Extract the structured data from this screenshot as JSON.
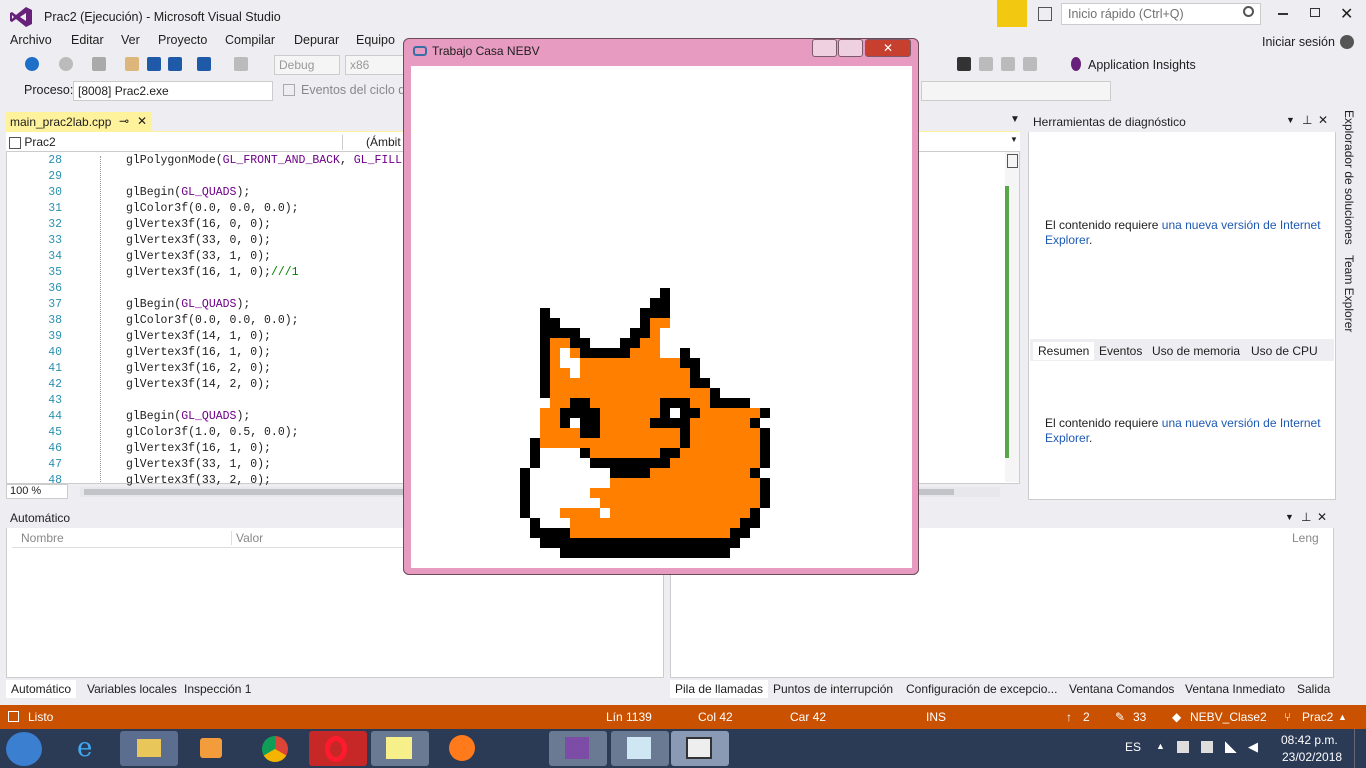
{
  "window": {
    "title": "Prac2 (Ejecución) - Microsoft Visual Studio",
    "quick_launch_placeholder": "Inicio rápido (Ctrl+Q)",
    "sign_in": "Iniciar sesión"
  },
  "menu": [
    "Archivo",
    "Editar",
    "Ver",
    "Proyecto",
    "Compilar",
    "Depurar",
    "Equipo"
  ],
  "toolbar": {
    "config": "Debug",
    "platform": "x86",
    "app_insights": "Application Insights",
    "process_label": "Proceso:",
    "process_value": "[8008] Prac2.exe",
    "lifecycle_events": "Eventos del ciclo de"
  },
  "editor": {
    "tab_name": "main_prac2lab.cpp",
    "nav_left": "Prac2",
    "nav_mid": "(Ámbit",
    "zoom": "100 %",
    "lines": [
      {
        "n": "28",
        "t": "glPolygonMode(GL_FRONT_AND_BACK, GL_FILL"
      },
      {
        "n": "29",
        "t": ""
      },
      {
        "n": "30",
        "t": "glBegin(GL_QUADS);"
      },
      {
        "n": "31",
        "t": "glColor3f(0.0, 0.0, 0.0);"
      },
      {
        "n": "32",
        "t": "glVertex3f(16, 0, 0);"
      },
      {
        "n": "33",
        "t": "glVertex3f(33, 0, 0);"
      },
      {
        "n": "34",
        "t": "glVertex3f(33, 1, 0);"
      },
      {
        "n": "35",
        "t": "glVertex3f(16, 1, 0);",
        "c": "///1"
      },
      {
        "n": "36",
        "t": ""
      },
      {
        "n": "37",
        "t": "glBegin(GL_QUADS);"
      },
      {
        "n": "38",
        "t": "glColor3f(0.0, 0.0, 0.0);"
      },
      {
        "n": "39",
        "t": "glVertex3f(14, 1, 0);"
      },
      {
        "n": "40",
        "t": "glVertex3f(16, 1, 0);"
      },
      {
        "n": "41",
        "t": "glVertex3f(16, 2, 0);"
      },
      {
        "n": "42",
        "t": "glVertex3f(14, 2, 0);"
      },
      {
        "n": "43",
        "t": ""
      },
      {
        "n": "44",
        "t": "glBegin(GL_QUADS);"
      },
      {
        "n": "45",
        "t": "glColor3f(1.0, 0.5, 0.0);"
      },
      {
        "n": "46",
        "t": "glVertex3f(16, 1, 0);"
      },
      {
        "n": "47",
        "t": "glVertex3f(33, 1, 0);"
      },
      {
        "n": "48",
        "t": "glVertex3f(33, 2, 0);"
      }
    ]
  },
  "diagnostics": {
    "title": "Herramientas de diagnóstico",
    "msg_text": "El contenido requiere",
    "msg_link": "una nueva versión de Internet",
    "msg_link2": "Explorer",
    "tabs": [
      "Resumen",
      "Eventos",
      "Uso de memoria",
      "Uso de CPU"
    ]
  },
  "side": [
    "Explorador de soluciones",
    "Team Explorer"
  ],
  "auto_panel": {
    "title": "Automático",
    "col_name": "Nombre",
    "col_value": "Valor",
    "col_lang": "Leng"
  },
  "bottom_tabs_left": [
    "Automático",
    "Variables locales",
    "Inspección 1"
  ],
  "bottom_tabs_right": [
    "Pila de llamadas",
    "Puntos de interrupción",
    "Configuración de excepcio...",
    "Ventana Comandos",
    "Ventana Inmediato",
    "Salida"
  ],
  "status": {
    "ready": "Listo",
    "line": "Lín 1139",
    "col": "Col 42",
    "car": "Car 42",
    "ins": "INS",
    "up": "2",
    "edits": "33",
    "repo": "NEBV_Clase2",
    "branch": "Prac2"
  },
  "taskbar": {
    "lang": "ES",
    "time": "08:42 p.m.",
    "date": "23/02/2018"
  },
  "popup": {
    "title": "Trabajo Casa NEBV"
  },
  "colors": {
    "orange": "#ff8000",
    "status": "#ca5100",
    "popup_frame": "#e79bc1"
  }
}
